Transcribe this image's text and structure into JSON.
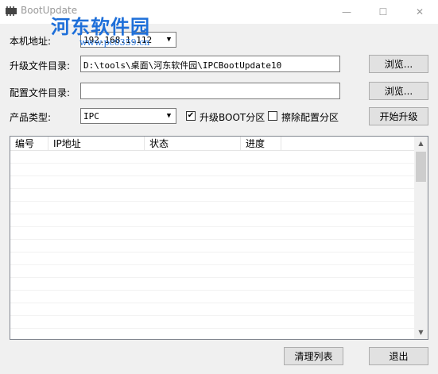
{
  "window": {
    "title": "BootUpdate",
    "minimize_glyph": "—",
    "maximize_glyph": "☐",
    "close_glyph": "✕",
    "watermark": "河东软件园",
    "watermark_url": "www.pc0359.cn"
  },
  "form": {
    "local_addr_label": "本机地址:",
    "local_addr_value": "192.168.1.112",
    "upgrade_dir_label": "升级文件目录:",
    "upgrade_dir_value": "D:\\tools\\桌面\\河东软件园\\IPCBootUpdate10",
    "browse_label_1": "浏览...",
    "config_dir_label": "配置文件目录:",
    "config_dir_value": "",
    "browse_label_2": "浏览...",
    "product_type_label": "产品类型:",
    "product_type_value": "IPC",
    "upgrade_boot_label": "升级BOOT分区",
    "upgrade_boot_checked": "✔",
    "erase_config_label": "擦除配置分区",
    "start_upgrade_label": "开始升级"
  },
  "table": {
    "columns": [
      "编号",
      "IP地址",
      "状态",
      "进度"
    ]
  },
  "footer": {
    "clear_list_label": "清理列表",
    "exit_label": "退出"
  },
  "icons": {
    "dropdown": "▼",
    "scroll_up": "▲",
    "scroll_down": "▼"
  }
}
